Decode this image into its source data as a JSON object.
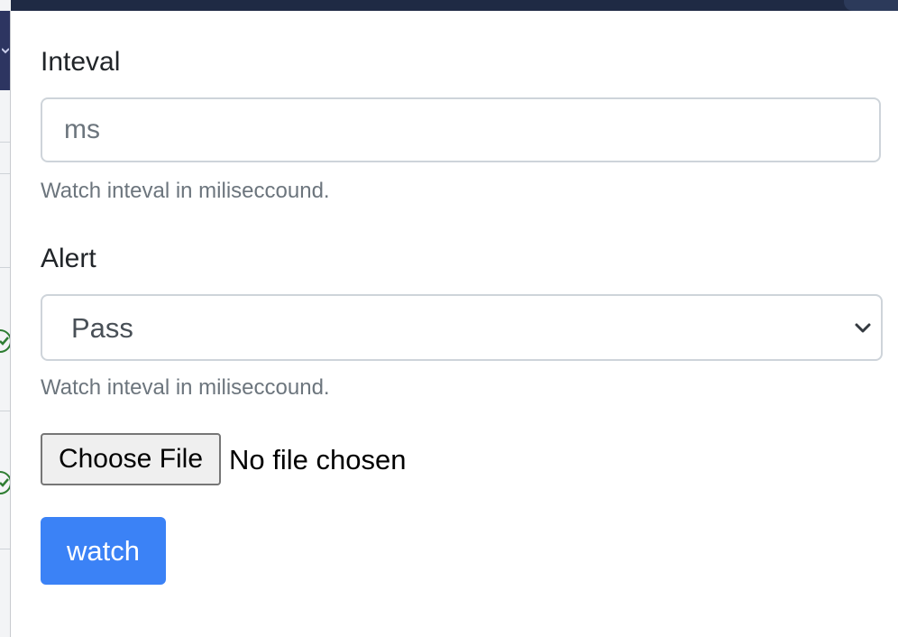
{
  "form": {
    "interval": {
      "label": "Inteval",
      "value": "",
      "placeholder": "ms",
      "help": "Watch inteval in miliseccound."
    },
    "alert": {
      "label": "Alert",
      "selected": "Pass",
      "help": "Watch inteval in miliseccound."
    },
    "file": {
      "button_label": "Choose File",
      "status": "No file chosen"
    },
    "submit": {
      "label": "watch",
      "color": "#3b82f6"
    }
  },
  "icons": {
    "select_arrow": "chevron-down-icon",
    "row_status": "check-circle-icon"
  }
}
